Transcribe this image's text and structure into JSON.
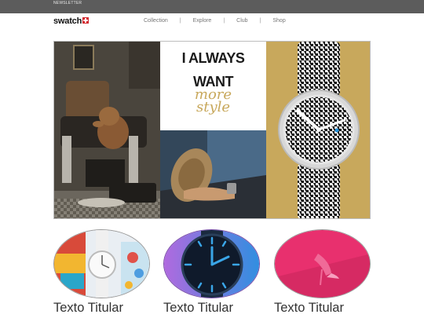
{
  "topbar": {
    "newsletter": "NEWSLETTER"
  },
  "brand": {
    "name": "swatch"
  },
  "nav": {
    "items": [
      "Collection",
      "Explore",
      "Club",
      "Shop"
    ]
  },
  "hero": {
    "quote_line1": "I ALWAYS",
    "quote_line2": "WANT",
    "quote_line3": "more",
    "quote_line4": "style"
  },
  "cards": [
    {
      "title": "Texto Titular"
    },
    {
      "title": "Texto Titular"
    },
    {
      "title": "Texto Titular"
    }
  ],
  "colors": {
    "accent_red": "#d2232a",
    "gold": "#c8a85c",
    "pink": "#e8306e",
    "blue": "#1f8fd8"
  }
}
